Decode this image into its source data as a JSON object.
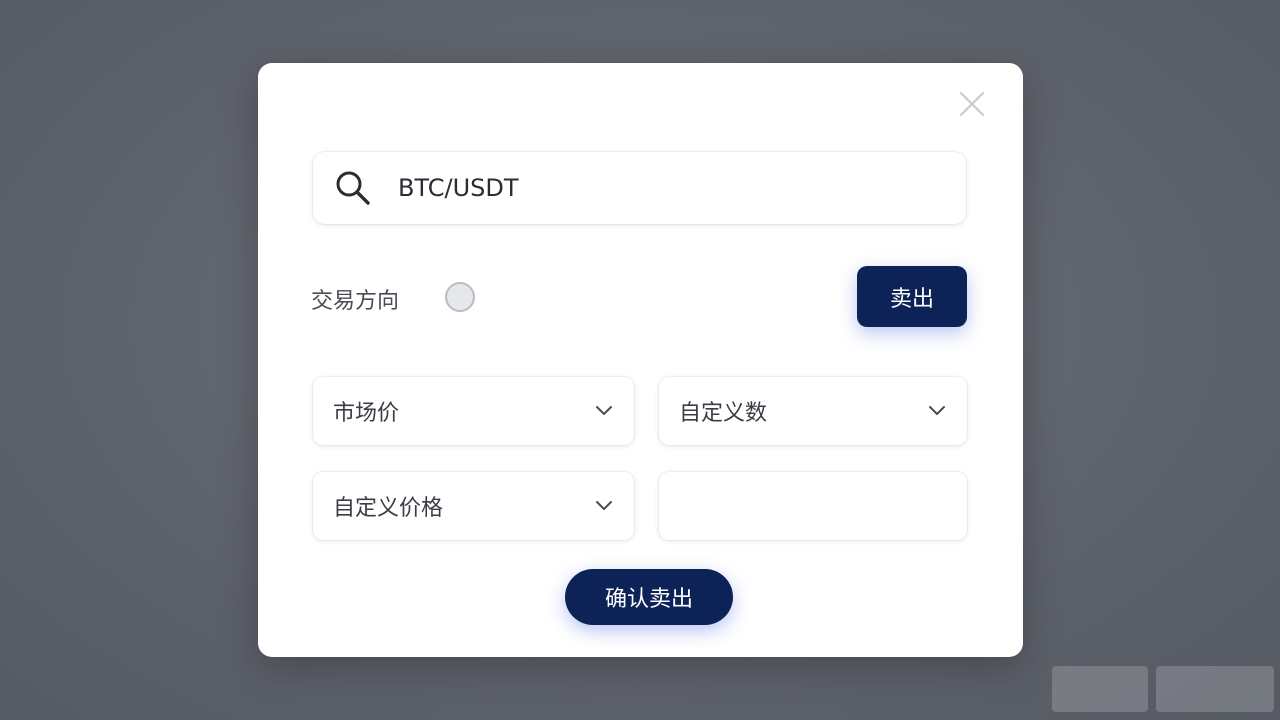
{
  "search": {
    "value": "BTC/USDT",
    "icon": "search-icon"
  },
  "direction": {
    "label": "交易方向"
  },
  "buttons": {
    "sell_label": "卖出",
    "confirm_label": "确认卖出"
  },
  "fields": {
    "order_type": "市场价",
    "amount_type": "自定义数",
    "price_type": "自定义价格",
    "price_value": ""
  },
  "colors": {
    "primary": "#0d2257",
    "overlay": "#62666f",
    "glow": "#3c5adc"
  }
}
